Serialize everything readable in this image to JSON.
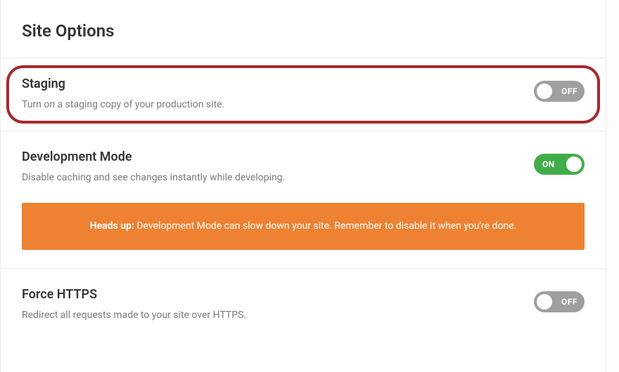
{
  "header": {
    "title": "Site Options"
  },
  "toggle_labels": {
    "on": "ON",
    "off": "OFF"
  },
  "sections": {
    "staging": {
      "title": "Staging",
      "desc": "Turn on a staging copy of your production site.",
      "state": "off"
    },
    "devmode": {
      "title": "Development Mode",
      "desc": "Disable caching and see changes instantly while developing.",
      "state": "on",
      "notice_bold": "Heads up:",
      "notice_rest": " Development Mode can slow down your site. Remember to disable it when you're done."
    },
    "https": {
      "title": "Force HTTPS",
      "desc": "Redirect all requests made to your site over HTTPS.",
      "state": "off"
    }
  },
  "colors": {
    "highlight_border": "#a8282a",
    "notice_bg": "#ee8132",
    "toggle_on": "#41ad49",
    "toggle_off": "#9f9f9f"
  }
}
